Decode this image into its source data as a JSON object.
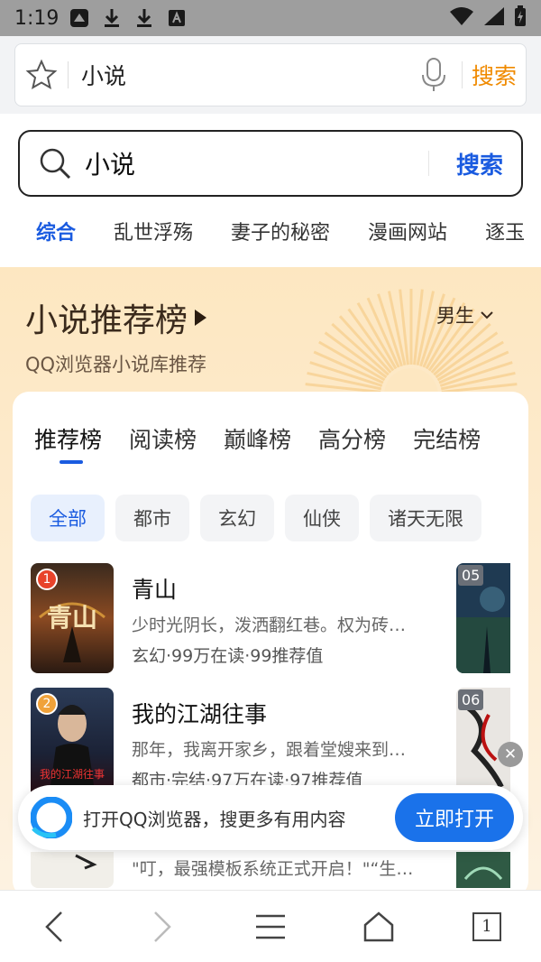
{
  "status_bar": {
    "time": "1:19"
  },
  "address_bar": {
    "query": "小说",
    "search_label": "搜索"
  },
  "page_search": {
    "query": "小说",
    "button": "搜索"
  },
  "query_tabs": [
    "综合",
    "乱世浮殇",
    "妻子的秘密",
    "漫画网站",
    "逐玉"
  ],
  "recommend": {
    "title": "小说推荐榜",
    "subtitle": "QQ浏览器小说库推荐",
    "gender": "男生",
    "rank_tabs": [
      "推荐榜",
      "阅读榜",
      "巅峰榜",
      "高分榜",
      "完结榜"
    ],
    "chips": [
      "全部",
      "都市",
      "玄幻",
      "仙侠",
      "诸天无限"
    ],
    "books": [
      {
        "rank": "1",
        "title": "青山",
        "desc": "少时光阴长，泼洒翻红巷。权为砖…",
        "meta": "玄幻·99万在读·99推荐值"
      },
      {
        "rank": "2",
        "title": "我的江湖往事",
        "desc": "那年，我离开家乡，跟着堂嫂来到…",
        "meta": "都市·完结·97万在读·97推荐值"
      }
    ],
    "side_ranks": [
      "05",
      "06"
    ],
    "row3_desc": "\"叮，最强模板系统正式开启！\"“生…"
  },
  "banner": {
    "text": "打开QQ浏览器，搜更多有用内容",
    "button": "立即打开",
    "close": "✕"
  },
  "bottom_nav": {
    "tab_count": "1"
  },
  "colors": {
    "accent": "#1a5be0",
    "orange": "#f08a00"
  }
}
